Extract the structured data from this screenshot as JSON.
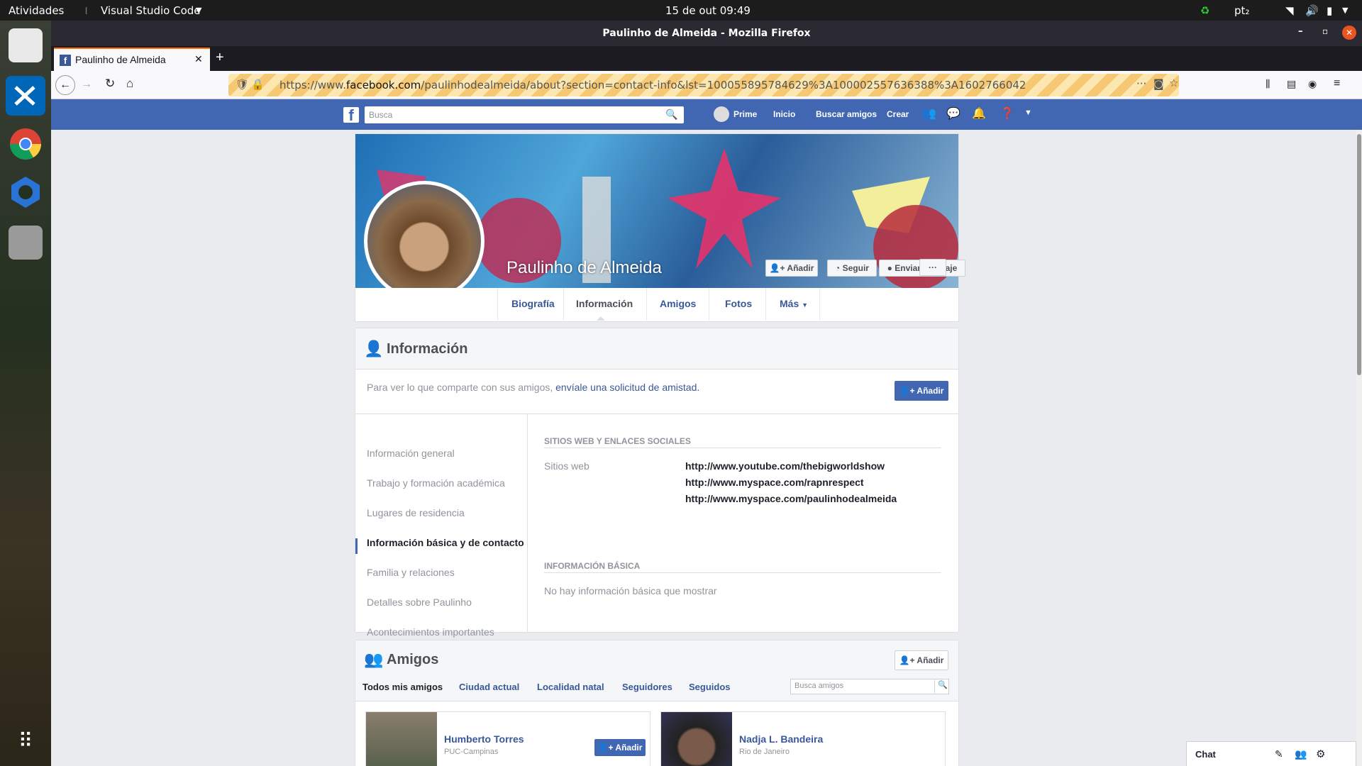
{
  "topbar": {
    "activities": "Atividades",
    "app": "Visual Studio Code",
    "datetime": "15 de out  09:49",
    "lang": "pt₂"
  },
  "window": {
    "title": "Paulinho de Almeida - Mozilla Firefox"
  },
  "tab": {
    "title": "Paulinho de Almeida"
  },
  "url": {
    "prefix": "https://www.",
    "domain": "facebook.com",
    "path": "/paulinhodealmeida/about?section=contact-info&lst=100055895784629%3A100002557636388%3A1602766042"
  },
  "fb": {
    "search_placeholder": "Busca",
    "user": "Prime",
    "home": "Inicio",
    "find_friends": "Buscar amigos",
    "create": "Crear"
  },
  "profile": {
    "name": "Paulinho de Almeida",
    "add": "Añadir",
    "follow": "Seguir",
    "message": "Enviar mensaje",
    "more": "···"
  },
  "tabs": {
    "bio": "Biografía",
    "info": "Información",
    "friends": "Amigos",
    "photos": "Fotos",
    "more": "Más"
  },
  "info": {
    "title": "Información",
    "notice": "Para ver lo que comparte con sus amigos, ",
    "notice_link": "envíale una solicitud de amistad.",
    "add": "Añadir",
    "sidebar": [
      "Información general",
      "Trabajo y formación académica",
      "Lugares de residencia",
      "Información básica y de contacto",
      "Familia y relaciones",
      "Detalles sobre Paulinho",
      "Acontecimientos importantes"
    ],
    "websites_header": "SITIOS WEB Y ENLACES SOCIALES",
    "websites_label": "Sitios web",
    "websites": [
      "http://www.youtube.com/thebigworldshow",
      "http://www.myspace.com/rapnrespect",
      "http://www.myspace.com/paulinhodealmeida"
    ],
    "basic_header": "INFORMACIÓN BÁSICA",
    "basic_empty": "No hay información básica que mostrar"
  },
  "friends": {
    "title": "Amigos",
    "add": "Añadir",
    "tabs": [
      "Todos mis amigos",
      "Ciudad actual",
      "Localidad natal",
      "Seguidores",
      "Seguidos"
    ],
    "search_placeholder": "Busca amigos",
    "list": [
      {
        "name": "Humberto Torres",
        "sub": "PUC-Campinas",
        "add": "Añadir"
      },
      {
        "name": "Nadja L. Bandeira",
        "sub": "Rio de Janeiro"
      }
    ]
  },
  "chat": {
    "label": "Chat"
  }
}
